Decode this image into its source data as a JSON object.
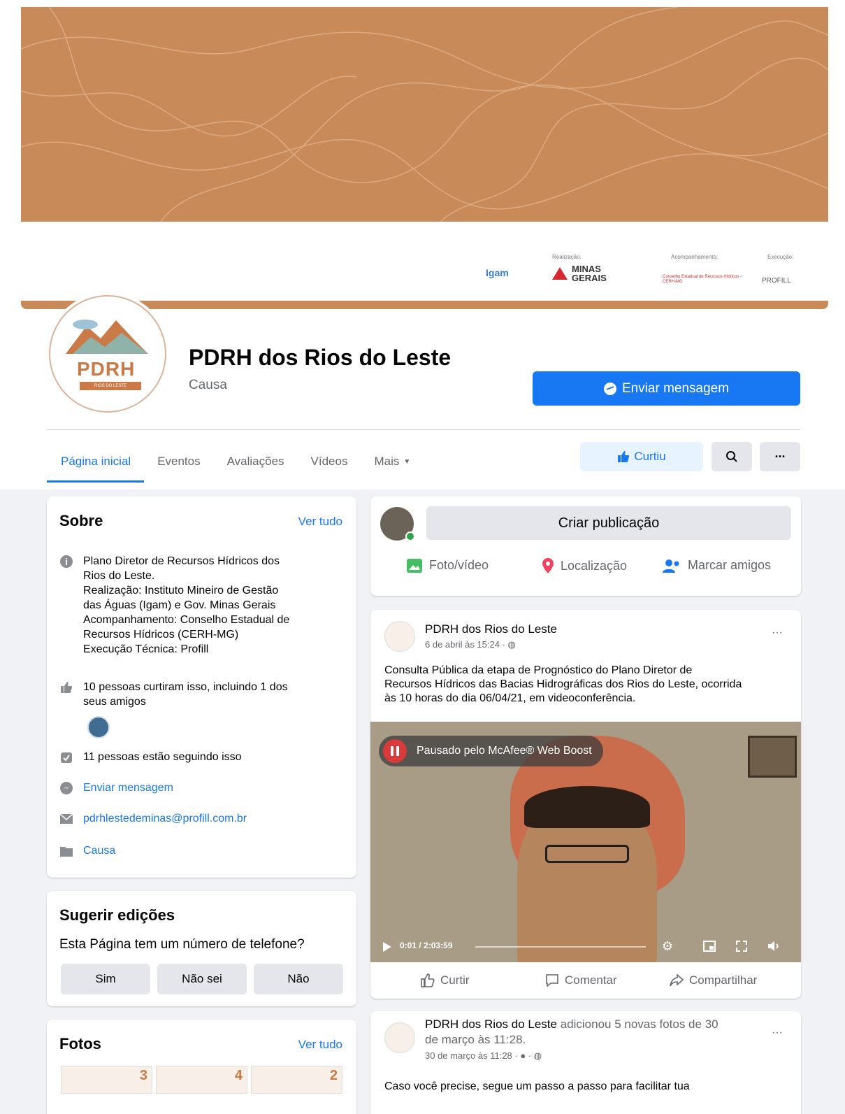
{
  "cover": {
    "sponsor_realizacao": "Realização:",
    "sponsor_acompanhamento": "Acompanhamento:",
    "sponsor_execucao": "Execução:",
    "igam": "Igam",
    "minas": "MINAS\nGERAIS",
    "cerh": "Conselho Estadual de Recursos Hídricos - CERH-MG",
    "profill": "PROFILL"
  },
  "profile": {
    "avatar_word": "PDRH",
    "avatar_tag": "RIOS DO LESTE",
    "name": "PDRH dos Rios do Leste",
    "category": "Causa",
    "message_button": "Enviar mensagem"
  },
  "tabs": [
    {
      "label": "Página inicial",
      "active": true
    },
    {
      "label": "Eventos"
    },
    {
      "label": "Avaliações"
    },
    {
      "label": "Vídeos"
    },
    {
      "label": "Mais"
    }
  ],
  "actions": {
    "liked": "Curtiu",
    "search_icon": "search-icon",
    "more_icon": "more-icon",
    "more_glyph": "···"
  },
  "about": {
    "title": "Sobre",
    "see_all": "Ver tudo",
    "description": "Plano Diretor de Recursos Hídricos dos\nRios do Leste.\nRealização: Instituto Mineiro de Gestão\ndas Águas (Igam) e Gov. Minas Gerais\nAcompanhamento: Conselho Estadual de\nRecursos Hídricos (CERH-MG)\nExecução Técnica: Profill",
    "likes": "10 pessoas curtiram isso, incluindo 1 dos\nseus amigos",
    "followers": "11 pessoas estão seguindo isso",
    "send_message": "Enviar mensagem",
    "email": "pdrhlestedeminas@profill.com.br",
    "category": "Causa"
  },
  "suggest": {
    "title": "Sugerir edições",
    "question": "Esta Página tem um número de telefone?",
    "options": [
      "Sim",
      "Não sei",
      "Não"
    ]
  },
  "photos": {
    "title": "Fotos",
    "see_all": "Ver tudo",
    "thumbs": [
      "3",
      "4",
      "2"
    ]
  },
  "composer": {
    "placeholder": "Criar publicação",
    "photo_video": "Foto/vídeo",
    "location": "Localização",
    "tag_friends": "Marcar amigos"
  },
  "post1": {
    "author": "PDRH dos Rios do Leste",
    "meta": "6 de abril às 15:24 · ",
    "more": "···",
    "text": "Consulta Pública da etapa de Prognóstico do Plano Diretor de\nRecursos Hídricos das Bacias Hidrográficas dos Rios do Leste, ocorrida\nàs 10 horas do dia 06/04/21, em videoconferência.",
    "paused": "Pausado pelo McAfee® Web Boost",
    "time": "0:01 / 2:03:59",
    "like": "Curtir",
    "comment": "Comentar",
    "share": "Compartilhar"
  },
  "post2": {
    "author": "PDRH dos Rios do Leste",
    "action": " adicionou 5 novas fotos de 30",
    "action2": "de março às 11:28.",
    "meta": "30 de março às 11:28 · ",
    "more": "···",
    "text": "Caso você precise, segue um passo a passo para facilitar tua"
  },
  "colors": {
    "accent": "#1877f2",
    "cover": "#c98a5a",
    "background": "#f0f2f5"
  }
}
